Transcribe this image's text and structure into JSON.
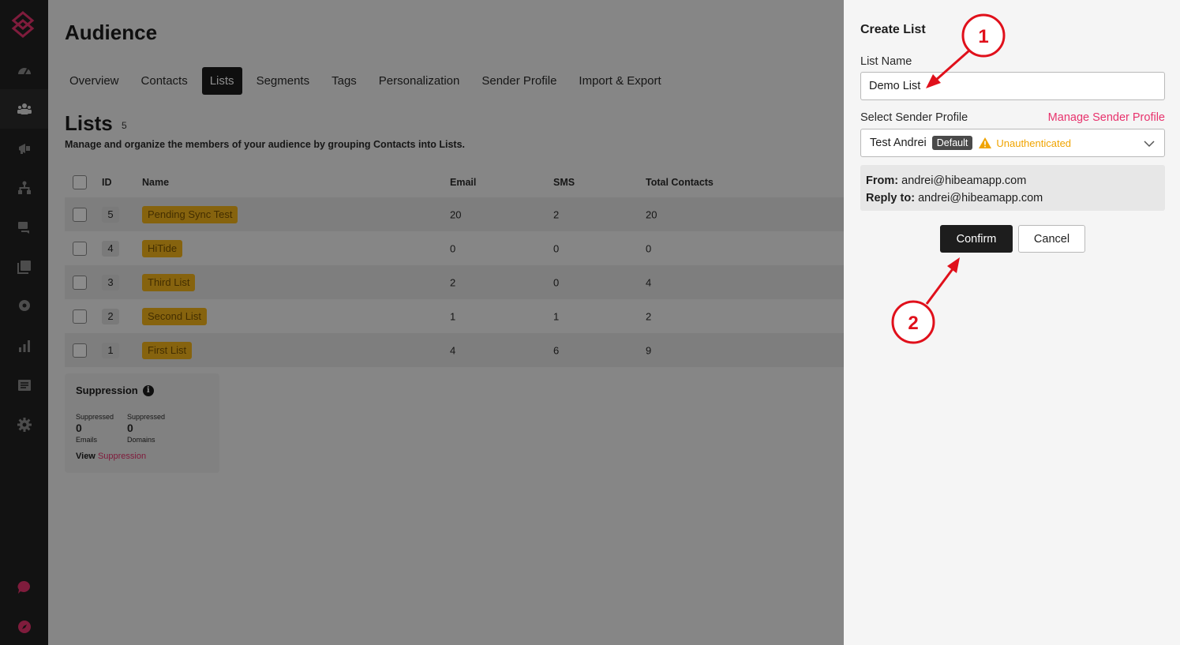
{
  "sidebar": {
    "items": [
      {
        "icon": "dashboard-icon"
      },
      {
        "icon": "audience-icon",
        "active": true
      },
      {
        "icon": "megaphone-icon"
      },
      {
        "icon": "flows-icon"
      },
      {
        "icon": "chat-icon"
      },
      {
        "icon": "templates-icon"
      },
      {
        "icon": "location-icon"
      },
      {
        "icon": "analytics-icon"
      },
      {
        "icon": "list-icon"
      },
      {
        "icon": "settings-icon"
      }
    ],
    "bottom_items": [
      {
        "icon": "support-chat-icon"
      },
      {
        "icon": "compass-icon"
      }
    ]
  },
  "header": {
    "title": "Audience"
  },
  "tabs": [
    {
      "label": "Overview"
    },
    {
      "label": "Contacts"
    },
    {
      "label": "Lists",
      "active": true
    },
    {
      "label": "Segments"
    },
    {
      "label": "Tags"
    },
    {
      "label": "Personalization"
    },
    {
      "label": "Sender Profile"
    },
    {
      "label": "Import & Export"
    }
  ],
  "lists": {
    "title": "Lists",
    "count": "5",
    "description": "Manage and organize the members of your audience by grouping Contacts into Lists."
  },
  "table": {
    "columns": {
      "id": "ID",
      "name": "Name",
      "email": "Email",
      "sms": "SMS",
      "total": "Total Contacts"
    },
    "rows": [
      {
        "id": "5",
        "name": "Pending Sync Test",
        "email": "20",
        "sms": "2",
        "total": "20"
      },
      {
        "id": "4",
        "name": "HiTide",
        "email": "0",
        "sms": "0",
        "total": "0"
      },
      {
        "id": "3",
        "name": "Third List",
        "email": "2",
        "sms": "0",
        "total": "4"
      },
      {
        "id": "2",
        "name": "Second List",
        "email": "1",
        "sms": "1",
        "total": "2"
      },
      {
        "id": "1",
        "name": "First List",
        "email": "4",
        "sms": "6",
        "total": "9"
      }
    ]
  },
  "suppression": {
    "title": "Suppression",
    "info": "i",
    "emails": {
      "top": "Suppressed",
      "value": "0",
      "bottom": "Emails"
    },
    "domains": {
      "top": "Suppressed",
      "value": "0",
      "bottom": "Domains"
    },
    "view_label": "View",
    "view_link": "Suppression"
  },
  "panel": {
    "title": "Create List",
    "list_name_label": "List Name",
    "list_name_value": "Demo List",
    "sender_label": "Select Sender Profile",
    "manage_link": "Manage Sender Profile",
    "sender_name": "Test Andrei",
    "default_badge": "Default",
    "status": "Unauthenticated",
    "from_label": "From:",
    "from_value": "andrei@hibeamapp.com",
    "reply_label": "Reply to:",
    "reply_value": "andrei@hibeamapp.com",
    "confirm_label": "Confirm",
    "cancel_label": "Cancel"
  },
  "annotations": {
    "step1": "1",
    "step2": "2"
  },
  "colors": {
    "brand_pink": "#e8336d",
    "tag_yellow": "#f5b51b",
    "warning": "#f0a400",
    "annotation_red": "#e0101b"
  }
}
